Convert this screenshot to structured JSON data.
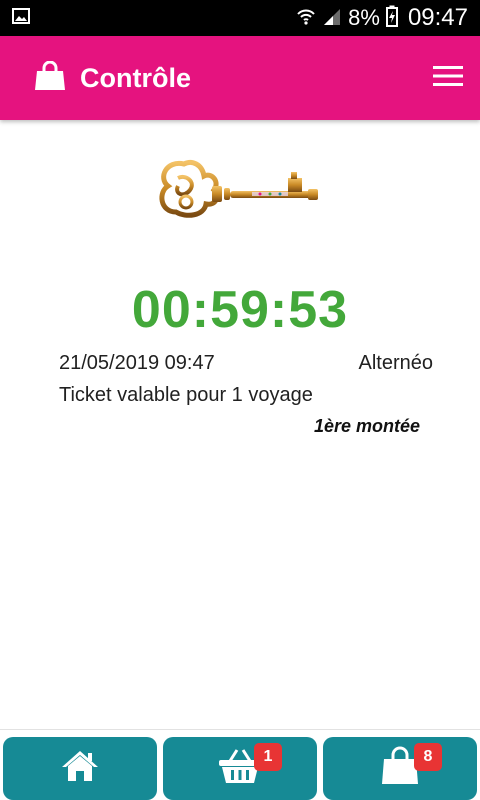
{
  "status_bar": {
    "battery": "8%",
    "time": "09:47"
  },
  "app_bar": {
    "title": "Contrôle",
    "left_icon": "shopping-bag-icon",
    "right_icon": "hamburger-menu-icon"
  },
  "ticket": {
    "countdown": "00:59:53",
    "datetime": "21/05/2019 09:47",
    "network": "Alternéo",
    "validity": "Ticket valable pour 1 voyage",
    "boarding": "1ère montée"
  },
  "bottom_nav": {
    "home_icon": "home-icon",
    "cart_icon": "basket-icon",
    "cart_count": "1",
    "bag_icon": "shopping-bag-icon",
    "bag_count": "8"
  },
  "colors": {
    "app_bar": "#e5137f",
    "timer": "#43a83a",
    "nav": "#168a95",
    "badge": "#e83434"
  }
}
